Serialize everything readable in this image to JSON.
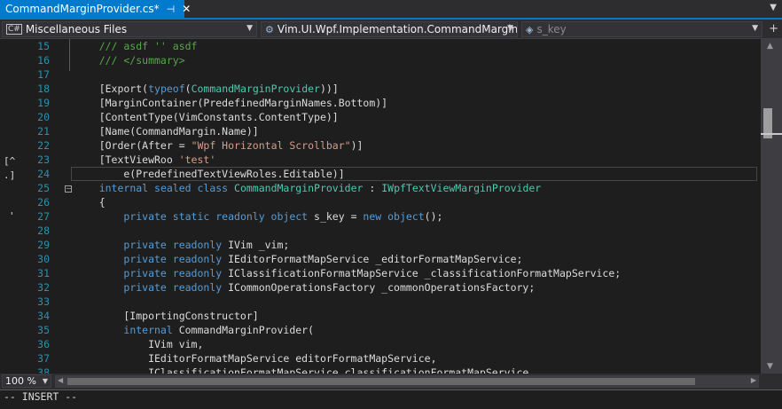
{
  "tab": {
    "title": "CommandMarginProvider.cs*",
    "pin": "⊣",
    "close": "✕"
  },
  "navbar": {
    "project": "Miscellaneous Files",
    "type_member": "Vim.UI.Wpf.Implementation.CommandMargin.C",
    "member": "s_key"
  },
  "left_margin": [
    "[^",
    ".]",
    "'"
  ],
  "code_lines": [
    {
      "no": "15",
      "segments": [
        {
          "t": "    /// asdf '' asdf",
          "c": "cm"
        }
      ]
    },
    {
      "no": "16",
      "segments": [
        {
          "t": "    /// </summary>",
          "c": "cm"
        }
      ]
    },
    {
      "no": "17",
      "segments": []
    },
    {
      "no": "18",
      "segments": [
        {
          "t": "    [Export(",
          "c": ""
        },
        {
          "t": "typeof",
          "c": "kw"
        },
        {
          "t": "(",
          "c": ""
        },
        {
          "t": "CommandMarginProvider",
          "c": "ty"
        },
        {
          "t": "))]",
          "c": ""
        }
      ]
    },
    {
      "no": "19",
      "segments": [
        {
          "t": "    [MarginContainer(PredefinedMarginNames.Bottom)]",
          "c": ""
        }
      ]
    },
    {
      "no": "20",
      "segments": [
        {
          "t": "    [ContentType(VimConstants.ContentType)]",
          "c": ""
        }
      ]
    },
    {
      "no": "21",
      "segments": [
        {
          "t": "    [Name(CommandMargin.Name)]",
          "c": ""
        }
      ]
    },
    {
      "no": "22",
      "segments": [
        {
          "t": "    [Order(After = ",
          "c": ""
        },
        {
          "t": "\"Wpf Horizontal Scrollbar\"",
          "c": "str"
        },
        {
          "t": ")]",
          "c": ""
        }
      ]
    },
    {
      "no": "23",
      "segments": [
        {
          "t": "    [TextViewRoo ",
          "c": ""
        },
        {
          "t": "'test'",
          "c": "str"
        }
      ]
    },
    {
      "no": "24",
      "segments": [
        {
          "t": "        e(PredefinedTextViewRoles.Editable)]",
          "c": ""
        }
      ]
    },
    {
      "no": "25",
      "segments": [
        {
          "t": "    ",
          "c": ""
        },
        {
          "t": "internal sealed class ",
          "c": "kw"
        },
        {
          "t": "CommandMarginProvider",
          "c": "ty"
        },
        {
          "t": " : ",
          "c": ""
        },
        {
          "t": "IWpfTextViewMarginProvider",
          "c": "ty"
        }
      ]
    },
    {
      "no": "26",
      "segments": [
        {
          "t": "    {",
          "c": ""
        }
      ]
    },
    {
      "no": "27",
      "segments": [
        {
          "t": "        ",
          "c": ""
        },
        {
          "t": "private static readonly object",
          "c": "kw"
        },
        {
          "t": " s_key = ",
          "c": ""
        },
        {
          "t": "new object",
          "c": "kw"
        },
        {
          "t": "();",
          "c": ""
        }
      ]
    },
    {
      "no": "28",
      "segments": []
    },
    {
      "no": "29",
      "segments": [
        {
          "t": "        ",
          "c": ""
        },
        {
          "t": "private readonly",
          "c": "kw"
        },
        {
          "t": " IVim _vim;",
          "c": ""
        }
      ]
    },
    {
      "no": "30",
      "segments": [
        {
          "t": "        ",
          "c": ""
        },
        {
          "t": "private readonly",
          "c": "kw"
        },
        {
          "t": " IEditorFormatMapService _editorFormatMapService;",
          "c": ""
        }
      ]
    },
    {
      "no": "31",
      "segments": [
        {
          "t": "        ",
          "c": ""
        },
        {
          "t": "private readonly",
          "c": "kw"
        },
        {
          "t": " IClassificationFormatMapService _classificationFormatMapService;",
          "c": ""
        }
      ]
    },
    {
      "no": "32",
      "segments": [
        {
          "t": "        ",
          "c": ""
        },
        {
          "t": "private readonly",
          "c": "kw"
        },
        {
          "t": " ICommonOperationsFactory _commonOperationsFactory;",
          "c": ""
        }
      ]
    },
    {
      "no": "33",
      "segments": []
    },
    {
      "no": "34",
      "segments": [
        {
          "t": "        [ImportingConstructor]",
          "c": ""
        }
      ]
    },
    {
      "no": "35",
      "segments": [
        {
          "t": "        ",
          "c": ""
        },
        {
          "t": "internal",
          "c": "kw"
        },
        {
          "t": " CommandMarginProvider(",
          "c": ""
        }
      ]
    },
    {
      "no": "36",
      "segments": [
        {
          "t": "            IVim vim,",
          "c": ""
        }
      ]
    },
    {
      "no": "37",
      "segments": [
        {
          "t": "            IEditorFormatMapService editorFormatMapService,",
          "c": ""
        }
      ]
    },
    {
      "no": "38",
      "segments": [
        {
          "t": "            IClassificationFormatMapService classificationFormatMapService,",
          "c": ""
        }
      ]
    }
  ],
  "zoom": "100 %",
  "status": "-- INSERT --",
  "icons": {
    "cs_file": "C#",
    "member": "field-icon",
    "split": "+"
  }
}
